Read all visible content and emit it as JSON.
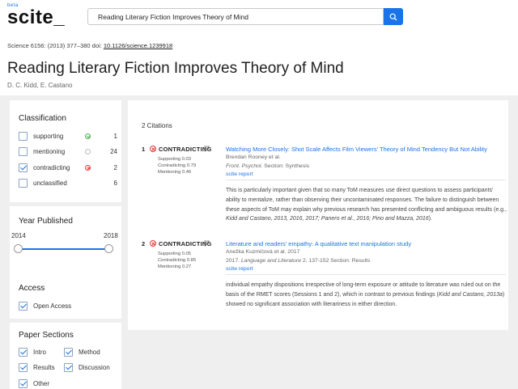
{
  "header": {
    "logo_beta": "beta",
    "logo_text": "scite_",
    "search_value": "Reading Literary Fiction Improves Theory of Mind"
  },
  "paper": {
    "meta_prefix": "Science 6156: (2013) 377–380 doi: ",
    "doi": "10.1126/science.1239918",
    "title": "Reading Literary Fiction Improves Theory of Mind",
    "authors": "D. C. Kidd, E. Castano"
  },
  "sidebar": {
    "classification": {
      "title": "Classification",
      "items": [
        {
          "label": "supporting",
          "count": "1",
          "checked": false,
          "status": "supporting"
        },
        {
          "label": "mentioning",
          "count": "24",
          "checked": false,
          "status": "mentioning"
        },
        {
          "label": "contradicting",
          "count": "2",
          "checked": true,
          "status": "contradicting"
        },
        {
          "label": "unclassified",
          "count": "6",
          "checked": false,
          "status": "none"
        }
      ]
    },
    "year": {
      "title": "Year Published",
      "min_label": "2014",
      "max_label": "2018"
    },
    "access": {
      "title": "Access",
      "option": "Open Access"
    },
    "sections": {
      "title": "Paper Sections",
      "items": [
        "Intro",
        "Method",
        "Results",
        "Discussion",
        "Other"
      ]
    }
  },
  "main": {
    "count_label": "2 Citations",
    "citations": [
      {
        "num": "1",
        "status": "CONTRADICTING",
        "supporting": "Supporting 0.03",
        "contradicting": "Contradicting 0.79",
        "mentioning": "Mentioning 0.46",
        "title": "Watching More Closely: Shot Scale Affects Film Viewers' Theory of Mind Tendency But Not Ability",
        "authors": "Brendan Rooney et al.",
        "journal": "Front. Psychol.",
        "section": " Section: Synthesis",
        "report": "scite report",
        "excerpt_a": "This is particularly important given that so many ToM measures use direct questions to assess participants' ability to mentalize, rather than observing their uncontaminated responses. The failure to distinguish between these aspects of ToM may explain why previous research has presented conflicting and ambiguous results (e.g., ",
        "excerpt_b": "Kidd and Castano, 2013, 2016, 2017; Panero et al., 2016; Pino and Mazza, 2016",
        "excerpt_c": ")."
      },
      {
        "num": "2",
        "status": "CONTRADICTING",
        "supporting": "Supporting 0.05",
        "contradicting": "Contradicting 0.85",
        "mentioning": "Mentioning 0.27",
        "title": "Literature and readers' empathy: A qualitative text manipulation study",
        "authors": "Anežka Kuzmičová et al. 2017",
        "journal_prefix": "2017. ",
        "journal": "Language and Literature",
        "section": " 2, 137-152 Section: Results",
        "report": "scite report",
        "excerpt_a": "individual empathy dispositions irrespective of long-term exposure or attitude to literature was ruled out on the basis of the RMET scores (Sessions 1 and 2), which in contrast to previous findings (",
        "excerpt_b": "Kidd and Castano, 2013a",
        "excerpt_c": ") showed no significant association with literariness in either direction."
      }
    ]
  },
  "colors": {
    "accent": "#1a73e8",
    "contradicting": "#e53935",
    "supporting": "#4caf50",
    "background": "#efefef"
  },
  "icons": {
    "search": "search-icon",
    "flag": "flag-icon",
    "contradicting": "x-circle-icon"
  }
}
